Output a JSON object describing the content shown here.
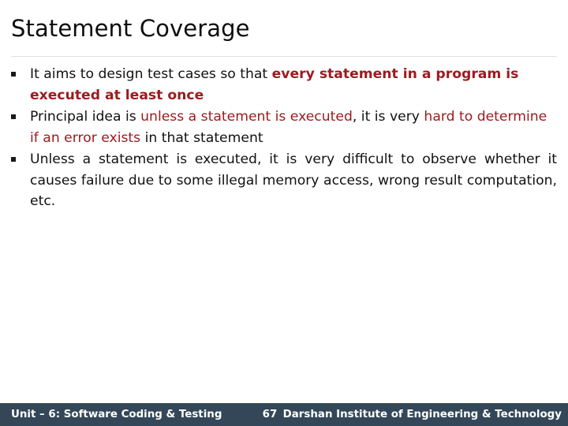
{
  "slide": {
    "title": "Statement Coverage",
    "bullet_marker_icon": "square-bullet-icon",
    "bullets": [
      {
        "id": "bullet-1",
        "segments": [
          {
            "text": "It aims to design test cases so that ",
            "style": "plain"
          },
          {
            "text": "every statement in a program is executed at least once",
            "style": "red-bold"
          }
        ],
        "justified": false
      },
      {
        "id": "bullet-2",
        "segments": [
          {
            "text": "Principal idea is ",
            "style": "plain"
          },
          {
            "text": "unless a statement is executed",
            "style": "red"
          },
          {
            "text": ", it is very ",
            "style": "plain"
          },
          {
            "text": "hard to determine if an error exists",
            "style": "red"
          },
          {
            "text": " in that statement",
            "style": "plain"
          }
        ],
        "justified": false
      },
      {
        "id": "bullet-3",
        "segments": [
          {
            "text": "Unless a statement is executed, it is very difficult to observe whether it causes failure due to some illegal memory access, wrong result computation, etc.",
            "style": "plain"
          }
        ],
        "justified": true
      }
    ]
  },
  "footer": {
    "left_text": "Unit – 6: Software Coding & Testing",
    "page_number": "67",
    "right_text": "Darshan Institute of Engineering & Technology",
    "background_color": "#334759",
    "text_color": "#ffffff"
  },
  "colors": {
    "accent_red": "#9c1b20",
    "title_text": "#0d0d0d",
    "body_text": "#111111",
    "rule": "#e2e2e2",
    "page_background": "#ffffff"
  }
}
